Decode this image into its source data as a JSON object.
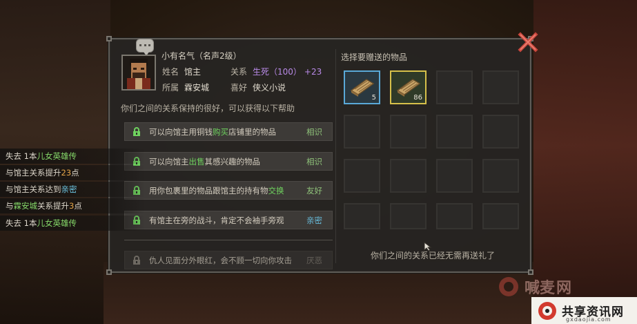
{
  "npc": {
    "title": "小有名气（名声2级）",
    "name_label": "姓名",
    "name": "馆主",
    "relation_label": "关系",
    "relation_value": "生死（100）",
    "relation_delta": "+23",
    "affiliation_label": "所属",
    "affiliation": "霖安城",
    "hobby_label": "喜好",
    "hobby": "侠义小说"
  },
  "help": {
    "description": "你们之间的关系保持的很好，可以获得以下帮助",
    "items": [
      {
        "pre": "可以向馆主用铜钱",
        "hl": "购买",
        "post": "店铺里的物品",
        "req": "相识",
        "hl_color": "green",
        "req_color": "green"
      },
      {
        "pre": "可以向馆主",
        "hl": "出售",
        "post": "其感兴趣的物品",
        "req": "相识",
        "hl_color": "green",
        "req_color": "green"
      },
      {
        "pre": "用你包裹里的物品跟馆主的持有物",
        "hl": "交换",
        "post": "",
        "req": "友好",
        "hl_color": "green",
        "req_color": "green"
      },
      {
        "pre": "",
        "hl": "",
        "post": "有馆主在旁的战斗，肯定不会袖手旁观",
        "req": "亲密",
        "hl_color": "green",
        "req_color": "cyan"
      },
      {
        "pre": "",
        "hl": "",
        "post": "仇人见面分外眼红，会不顾一切向你攻击",
        "req": "厌恶",
        "hl_color": "dim",
        "req_color": "dim"
      }
    ]
  },
  "gift": {
    "title": "选择要赠送的物品",
    "items": [
      {
        "name": "book",
        "count": "5"
      },
      {
        "name": "book",
        "count": "86"
      }
    ],
    "note": "你们之间的关系已经无需再送礼了"
  },
  "log": [
    [
      {
        "t": "失去 1本",
        "c": ""
      },
      {
        "t": "儿女英雄传",
        "c": "green"
      }
    ],
    [
      {
        "t": "与馆主关系提升",
        "c": ""
      },
      {
        "t": "23",
        "c": "orange"
      },
      {
        "t": "点",
        "c": ""
      }
    ],
    [
      {
        "t": "与馆主关系达到",
        "c": ""
      },
      {
        "t": "亲密",
        "c": "cyan"
      }
    ],
    [
      {
        "t": "与",
        "c": ""
      },
      {
        "t": "霖安城",
        "c": "green"
      },
      {
        "t": "关系提升",
        "c": ""
      },
      {
        "t": "3",
        "c": "orange"
      },
      {
        "t": "点",
        "c": ""
      }
    ],
    [
      {
        "t": "失去 1本",
        "c": ""
      },
      {
        "t": "儿女英雄传",
        "c": "green"
      }
    ]
  ],
  "watermarks": {
    "site1": "喊麦",
    "site1_suffix": "网",
    "site2": "共享资讯网",
    "site2_url": "gxdaojia.com"
  },
  "colors": {
    "highlight_green": "#6fd35f",
    "relation_purple": "#b98ae8",
    "req_cyan": "#67b9d8",
    "slot_blue": "#5aa9d8",
    "slot_gold": "#d6c04a",
    "close_red": "#c8463c"
  }
}
